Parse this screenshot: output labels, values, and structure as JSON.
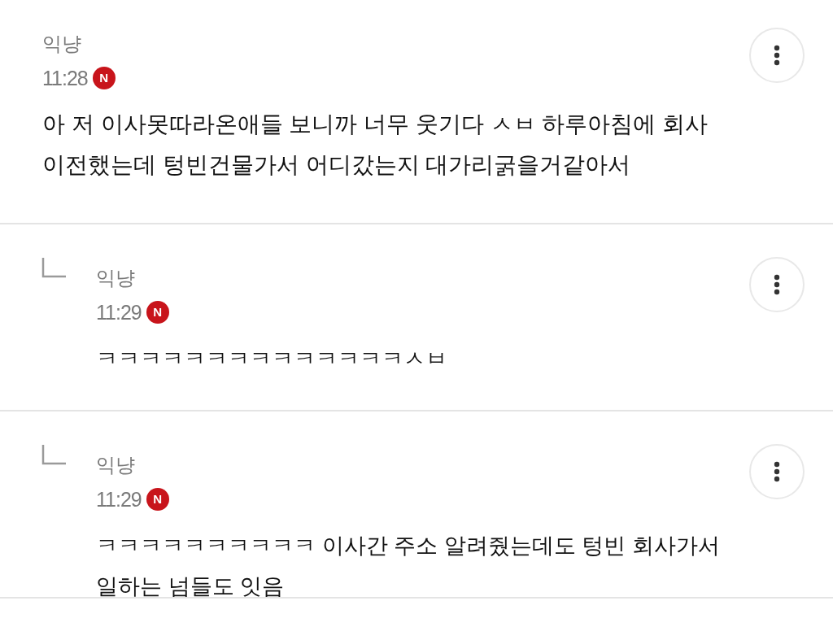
{
  "comments": [
    {
      "kind": "comment",
      "author": "익냥",
      "time": "11:28",
      "badge": "N",
      "body": "아 저 이사못따라온애들 보니까 너무 웃기다 ㅅㅂ 하루아침에 회사 이전했는데 텅빈건물가서 어디갔는지 대가리굵을거같아서"
    },
    {
      "kind": "reply",
      "author": "익냥",
      "time": "11:29",
      "badge": "N",
      "body": "ㅋㅋㅋㅋㅋㅋㅋㅋㅋㅋㅋㅋㅋㅋㅅㅂ"
    },
    {
      "kind": "reply",
      "author": "익냥",
      "time": "11:29",
      "badge": "N",
      "body": "ㅋㅋㅋㅋㅋㅋㅋㅋㅋㅋ 이사간 주소 알려줬는데도 텅빈 회사가서 일하는 넘들도 잇음"
    }
  ]
}
